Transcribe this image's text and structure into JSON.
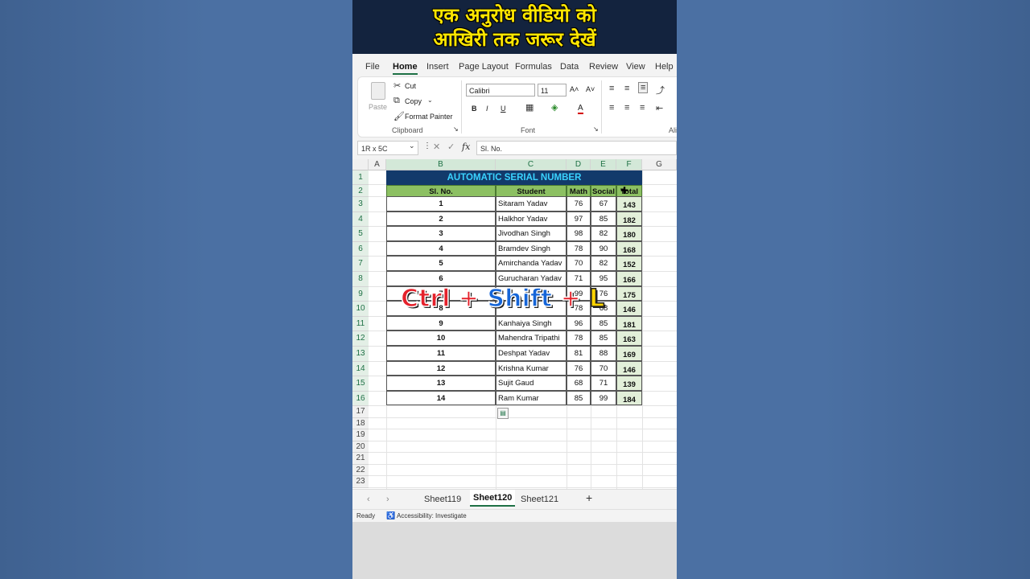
{
  "banner": {
    "line1": "एक अनुरोध वीडियो को",
    "line2": "आखिरी तक जरूर देखें"
  },
  "menu": [
    "File",
    "Home",
    "Insert",
    "Page Layout",
    "Formulas",
    "Data",
    "Review",
    "View",
    "Help"
  ],
  "menu_active": "Home",
  "ribbon": {
    "paste": "Paste",
    "cut": "Cut",
    "copy": "Copy",
    "format_painter": "Format Painter",
    "clipboard_group": "Clipboard",
    "font_name": "Calibri",
    "font_size": "11",
    "font_group": "Font",
    "bold": "B",
    "italic": "I",
    "underline": "U",
    "increase_font": "A˄",
    "decrease_font": "A˅",
    "font_color": "A",
    "align_group_partial": "Ali"
  },
  "formula_bar": {
    "name_box": "1R x 5C",
    "fx": "fx",
    "content": "Sl. No."
  },
  "columns": [
    "A",
    "B",
    "C",
    "D",
    "E",
    "F",
    "G"
  ],
  "rows": [
    "1",
    "2",
    "3",
    "4",
    "5",
    "6",
    "7",
    "8",
    "9",
    "10",
    "11",
    "12",
    "13",
    "14",
    "15",
    "16",
    "17",
    "18",
    "19",
    "20",
    "21",
    "22",
    "23"
  ],
  "table": {
    "title": "AUTOMATIC SERIAL NUMBER",
    "headers": [
      "Sl. No.",
      "Student",
      "Math",
      "Social",
      "Total"
    ],
    "data": [
      [
        "1",
        "Sitaram Yadav",
        "76",
        "67",
        "143"
      ],
      [
        "2",
        "Halkhor Yadav",
        "97",
        "85",
        "182"
      ],
      [
        "3",
        "Jivodhan Singh",
        "98",
        "82",
        "180"
      ],
      [
        "4",
        "Bramdev Singh",
        "78",
        "90",
        "168"
      ],
      [
        "5",
        "Amirchanda Yadav",
        "70",
        "82",
        "152"
      ],
      [
        "6",
        "Gurucharan Yadav",
        "71",
        "95",
        "166"
      ],
      [
        "7",
        "",
        "99",
        "76",
        "175"
      ],
      [
        "8",
        "",
        "78",
        "68",
        "146"
      ],
      [
        "9",
        "Kanhaiya Singh",
        "96",
        "85",
        "181"
      ],
      [
        "10",
        "Mahendra Tripathi",
        "78",
        "85",
        "163"
      ],
      [
        "11",
        "Deshpat Yadav",
        "81",
        "88",
        "169"
      ],
      [
        "12",
        "Krishna Kumar",
        "76",
        "70",
        "146"
      ],
      [
        "13",
        "Sujit Gaud",
        "68",
        "71",
        "139"
      ],
      [
        "14",
        "Ram Kumar",
        "85",
        "99",
        "184"
      ]
    ]
  },
  "overlay": {
    "ctrl": "Ctrl",
    "plus1": "+",
    "shift": "Shift",
    "plus2": "+",
    "l": "L"
  },
  "sheets": [
    "Sheet119",
    "Sheet120",
    "Sheet121"
  ],
  "active_sheet": "Sheet120",
  "status": {
    "ready": "Ready",
    "accessibility": "Accessibility: Investigate"
  },
  "colors": {
    "title_bg": "#123a6b",
    "title_fg": "#3ad3ff",
    "header_bg": "#8cc062",
    "total_bg": "#e2efd9",
    "excel_green": "#1e7145"
  }
}
